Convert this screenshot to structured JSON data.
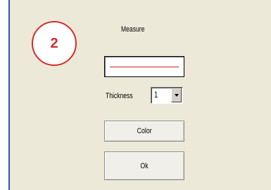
{
  "step": {
    "number": "2"
  },
  "dialog": {
    "title": "Measure",
    "line_color": "#c8211d",
    "thickness": {
      "label": "Thickness",
      "value": "1"
    },
    "buttons": {
      "color": "Color",
      "ok": "Ok"
    }
  },
  "colors": {
    "background": "#ece9d8",
    "accent_border": "#2a4fb8",
    "step_circle": "#d62b2b"
  }
}
